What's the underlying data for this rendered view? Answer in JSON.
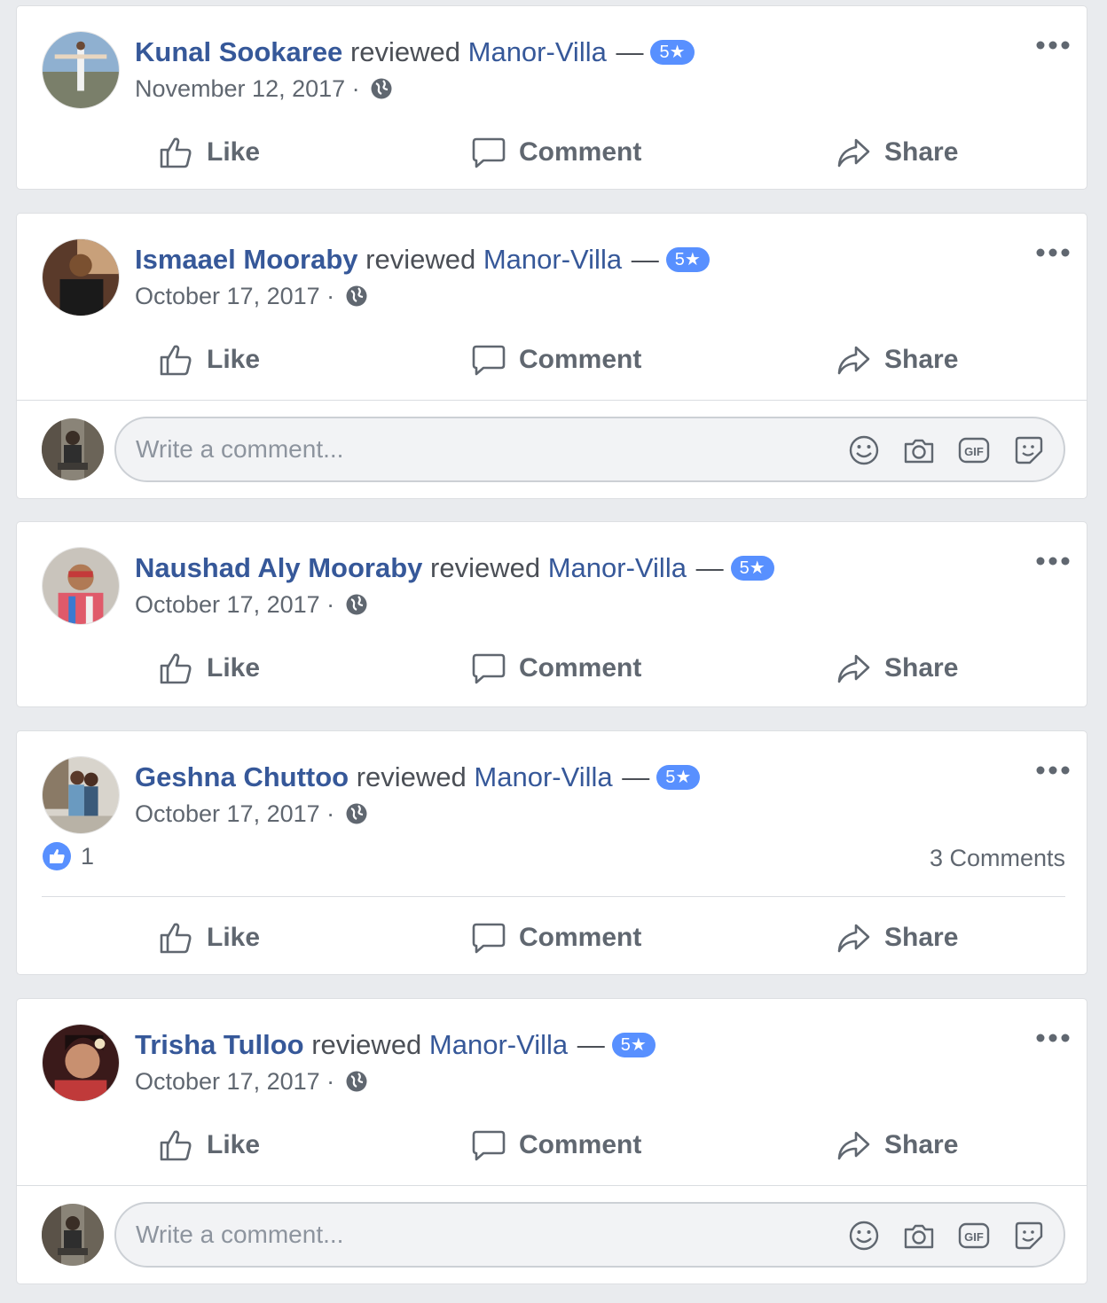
{
  "reviews": [
    {
      "author": "Kunal Sookaree",
      "verb": "reviewed",
      "page": "Manor-Villa",
      "dash": "—",
      "rating": "5★",
      "date": "November 12, 2017",
      "sep": "·"
    },
    {
      "author": "Ismaael Mooraby",
      "verb": "reviewed",
      "page": "Manor-Villa",
      "dash": "—",
      "rating": "5★",
      "date": "October 17, 2017",
      "sep": "·"
    },
    {
      "author": "Naushad Aly Mooraby",
      "verb": "reviewed",
      "page": "Manor-Villa",
      "dash": "—",
      "rating": "5★",
      "date": "October 17, 2017",
      "sep": "·"
    },
    {
      "author": "Geshna Chuttoo",
      "verb": "reviewed",
      "page": "Manor-Villa",
      "dash": "—",
      "rating": "5★",
      "date": "October 17, 2017",
      "sep": "·",
      "like_count": "1",
      "comment_count": "3 Comments"
    },
    {
      "author": "Trisha Tulloo",
      "verb": "reviewed",
      "page": "Manor-Villa",
      "dash": "—",
      "rating": "5★",
      "date": "October 17, 2017",
      "sep": "·"
    }
  ],
  "actions": {
    "like": "Like",
    "comment": "Comment",
    "share": "Share"
  },
  "comment_box": {
    "placeholder": "Write a comment..."
  },
  "colors": {
    "link": "#365899",
    "badge": "#5890ff",
    "muted": "#606770",
    "background": "#e9ebee"
  }
}
